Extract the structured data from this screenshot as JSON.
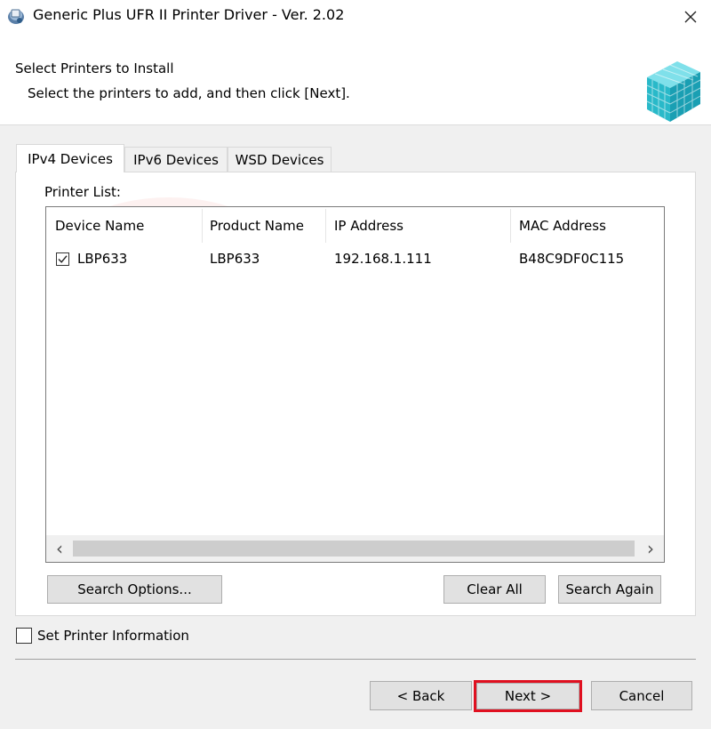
{
  "window": {
    "title": "Generic Plus UFR II Printer Driver - Ver. 2.02",
    "close_glyph": "✕",
    "app_icon": "printer-setup-icon"
  },
  "header": {
    "title": "Select Printers to Install",
    "subtitle": "Select the printers to add, and then click [Next].",
    "logo_icon": "canon-cube-logo"
  },
  "tabs": [
    {
      "label": "IPv4 Devices",
      "active": true
    },
    {
      "label": "IPv6 Devices",
      "active": false
    },
    {
      "label": "WSD Devices",
      "active": false
    }
  ],
  "printer_list": {
    "label": "Printer List:",
    "columns": [
      "Device Name",
      "Product Name",
      "IP Address",
      "MAC Address"
    ],
    "rows": [
      {
        "checked": true,
        "device_name": "LBP633",
        "product_name": "LBP633",
        "ip_address": "192.168.1.111",
        "mac_address": "B48C9DF0C115"
      }
    ],
    "scroll_left": "‹",
    "scroll_right": "›"
  },
  "buttons": {
    "search_options": "Search Options...",
    "clear_all": "Clear All",
    "search_again": "Search Again",
    "back": "< Back",
    "next": "Next >",
    "cancel": "Cancel"
  },
  "set_printer_info": {
    "label": "Set Printer Information",
    "checked": false
  },
  "colors": {
    "highlight": "#e01020",
    "logo": "#29b9c9",
    "watermark": "#e8322a"
  }
}
